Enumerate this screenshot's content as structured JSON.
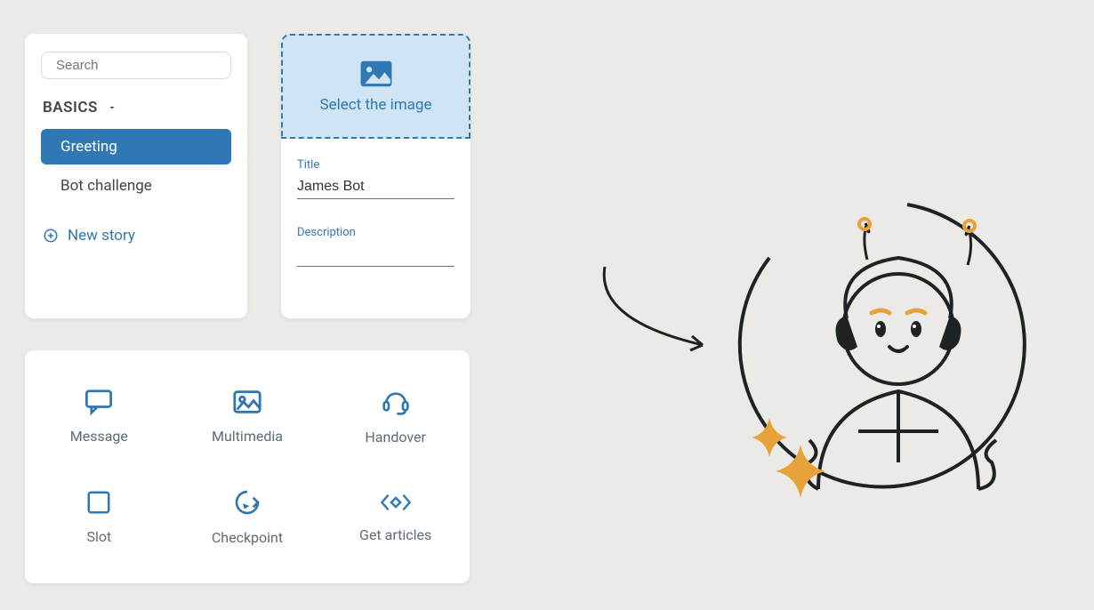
{
  "sidebar": {
    "search_placeholder": "Search",
    "category_label": "BASICS",
    "stories": [
      {
        "label": "Greeting",
        "active": true
      },
      {
        "label": "Bot challenge",
        "active": false
      }
    ],
    "new_story_label": "New story"
  },
  "detail": {
    "select_image_label": "Select the image",
    "title_label": "Title",
    "title_value": "James Bot",
    "description_label": "Description",
    "description_value": ""
  },
  "tray": {
    "items": [
      {
        "label": "Message"
      },
      {
        "label": "Multimedia"
      },
      {
        "label": "Handover"
      },
      {
        "label": "Slot"
      },
      {
        "label": "Checkpoint"
      },
      {
        "label": "Get articles"
      }
    ]
  },
  "colors": {
    "accent": "#2f78b4",
    "panel": "#ffffff",
    "bg": "#ebeae7",
    "sparkle": "#e8a23a"
  }
}
